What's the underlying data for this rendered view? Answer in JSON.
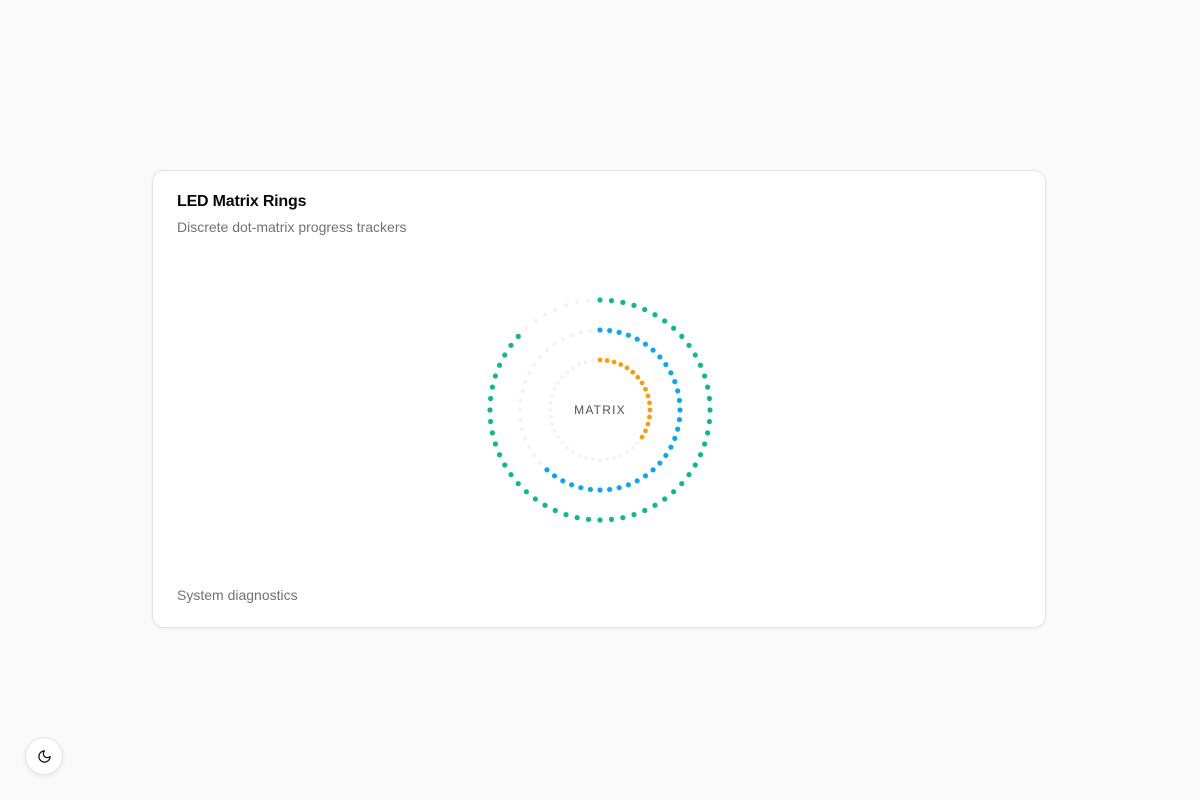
{
  "card": {
    "title": "LED Matrix Rings",
    "subtitle": "Discrete dot-matrix progress trackers",
    "footer": "System diagnostics"
  },
  "rings": {
    "center_label": "MATRIX",
    "track_color": "#f4f4f5",
    "items": [
      {
        "color": "#10b981",
        "progress": 0.88,
        "dots": 60
      },
      {
        "color": "#0ea5e9",
        "progress": 0.64,
        "dots": 52
      },
      {
        "color": "#f59e0b",
        "progress": 0.36,
        "dots": 44
      }
    ]
  },
  "theme_toggle": {
    "icon": "moon-icon"
  }
}
